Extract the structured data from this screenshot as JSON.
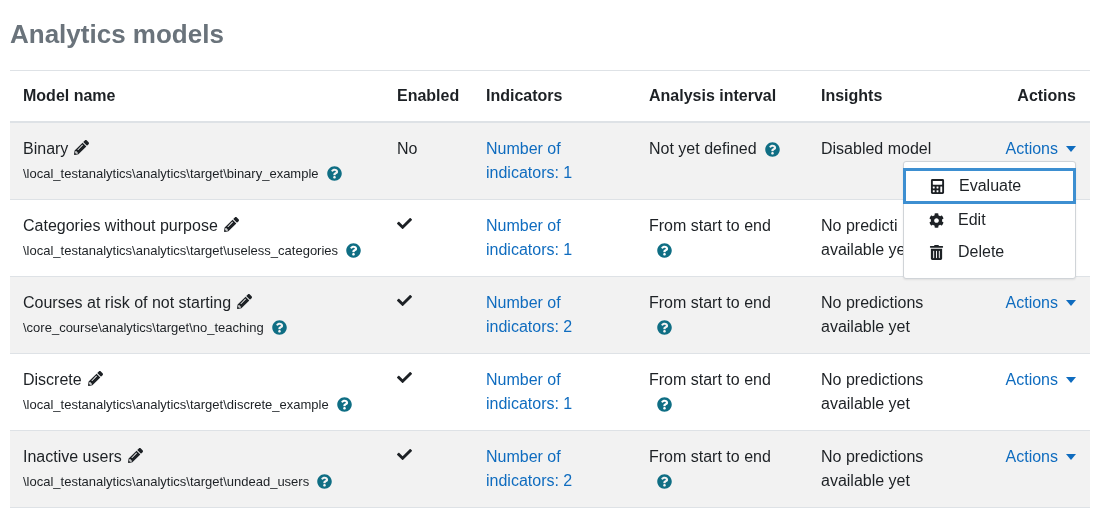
{
  "title": "Analytics models",
  "columns": [
    "Model name",
    "Enabled",
    "Indicators",
    "Analysis interval",
    "Insights",
    "Actions"
  ],
  "rows": [
    {
      "name": "Binary",
      "target": "\\local_testanalytics\\analytics\\target\\binary_example",
      "enabled": false,
      "enabled_label": "No",
      "indicators": "Number of indicators: 1",
      "interval": "Not yet defined",
      "insights": [
        "Disabled model"
      ],
      "actions": "Actions",
      "menu_open": true
    },
    {
      "name": "Categories without purpose",
      "target": "\\local_testanalytics\\analytics\\target\\useless_categories",
      "enabled": true,
      "indicators": "Number of indicators: 1",
      "interval": "From start to end",
      "insights": [
        "No predicti",
        "available ye"
      ],
      "menu_open": false
    },
    {
      "name": "Courses at risk of not starting",
      "target": "\\core_course\\analytics\\target\\no_teaching",
      "enabled": true,
      "indicators": "Number of indicators: 2",
      "interval": "From start to end",
      "insights": [
        "No predictions",
        "available yet"
      ],
      "actions": "Actions",
      "menu_open": false
    },
    {
      "name": "Discrete",
      "target": "\\local_testanalytics\\analytics\\target\\discrete_example",
      "enabled": true,
      "indicators": "Number of indicators: 1",
      "interval": "From start to end",
      "insights": [
        "No predictions",
        "available yet"
      ],
      "actions": "Actions",
      "menu_open": false
    },
    {
      "name": "Inactive users",
      "target": "\\local_testanalytics\\analytics\\target\\undead_users",
      "enabled": true,
      "indicators": "Number of indicators: 2",
      "interval": "From start to end",
      "insights": [
        "No predictions",
        "available yet"
      ],
      "actions": "Actions",
      "menu_open": false
    }
  ],
  "menu": [
    {
      "kind": "evaluate",
      "label": "Evaluate",
      "selected": true
    },
    {
      "kind": "edit",
      "label": "Edit",
      "selected": false
    },
    {
      "kind": "delete",
      "label": "Delete",
      "selected": false
    }
  ]
}
